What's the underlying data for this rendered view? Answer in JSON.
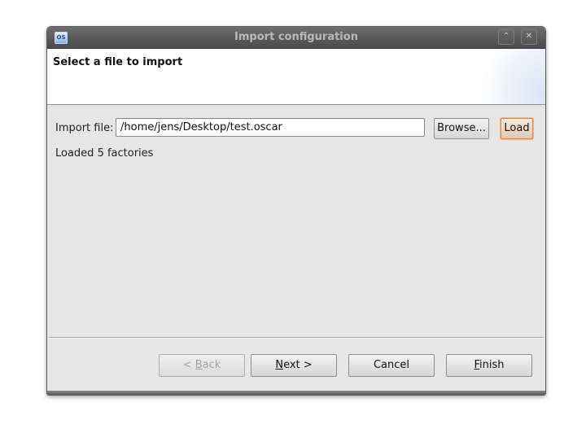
{
  "window": {
    "title": "Import configuration",
    "icon": "oscar-app-icon"
  },
  "banner": {
    "title": "Select a file to import"
  },
  "import": {
    "label": "Import file:",
    "value": "/home/jens/Desktop/test.oscar",
    "browse_label": "Browse...",
    "load_label": "Load",
    "status": "Loaded 5 factories"
  },
  "buttons": {
    "back": {
      "prefix": "< ",
      "mnemonic": "B",
      "rest": "ack"
    },
    "next": {
      "mnemonic": "N",
      "rest": "ext >"
    },
    "cancel": "Cancel",
    "finish": {
      "mnemonic": "F",
      "rest": "inish"
    }
  },
  "colors": {
    "focus_border": "#d9884a",
    "titlebar": "#4a4a4a",
    "dialog_bg": "#e6e6e6"
  }
}
